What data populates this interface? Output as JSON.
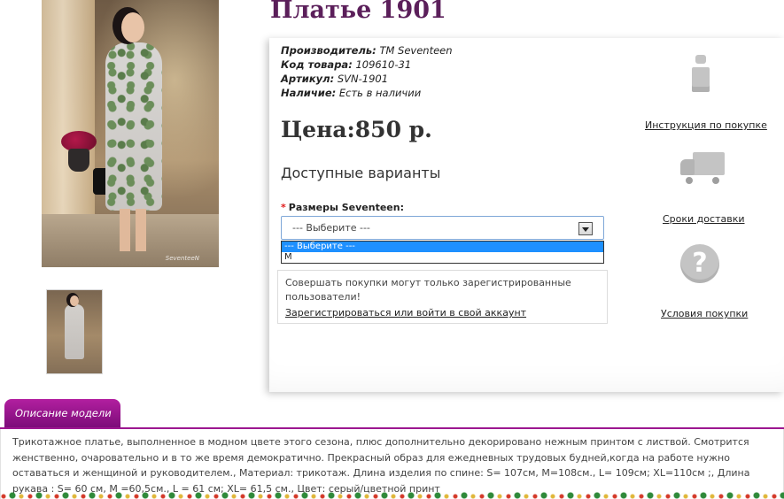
{
  "product": {
    "title": "Платье 1901",
    "specs": [
      {
        "label": "Производитель:",
        "value": "ТМ Seventeen"
      },
      {
        "label": "Код товара:",
        "value": "109610-31"
      },
      {
        "label": "Артикул:",
        "value": "SVN-1901"
      },
      {
        "label": "Наличие:",
        "value": "Есть в наличии"
      }
    ],
    "price": "Цена:850 р.",
    "variants_heading": "Доступные варианты",
    "size_label": "Размеры Seventeen:",
    "required_mark": "*",
    "size_select": {
      "selected": "--- Выберите ---",
      "options": [
        "--- Выберите ---",
        "M"
      ]
    },
    "photo_signature": "SeventeeN"
  },
  "notice": {
    "text": "Совершать покупки могут только зарегистрированные пользователи!",
    "link": "Зарегистрироваться или войти в свой аккаунт"
  },
  "side_links": {
    "instruction": "Инструкция по покупке",
    "delivery": "Сроки доставки",
    "terms": "Условия покупки"
  },
  "icons": {
    "info": "info-icon",
    "truck": "truck-icon",
    "help": "question-icon",
    "help_glyph": "?"
  },
  "description": {
    "tab_label": "Описание модели",
    "text": "Трикотажное платье, выполненное в модном цвете этого сезона, плюс дополнительно декорировано нежным принтом с листвой. Смотрится женственно, очаровательно и в то же время демократично. Прекрасный образ для ежедневных трудовых будней,когда на работе нужно оставаться и женщиной и руководителем., Материал: трикотаж. Длина изделия по спине: S= 107см, M=108см., L= 109см; XL=110см ;, Длина рукава : S= 60 см, M =60,5см., L = 61 см; XL= 61,5 см., Цвет: серый/цветной принт"
  },
  "colors": {
    "title": "#5b1f5a",
    "tab": "#9c1790",
    "select_border": "#7ea7d8",
    "option_highlight": "#1e90ff"
  }
}
